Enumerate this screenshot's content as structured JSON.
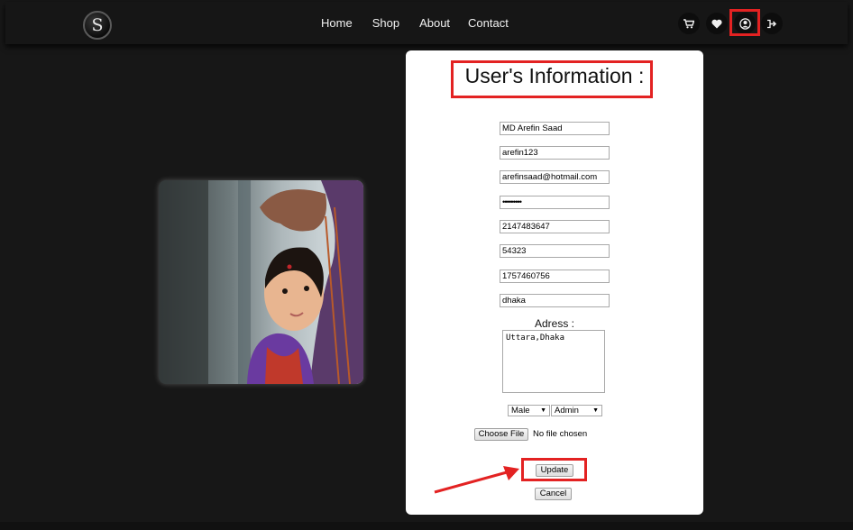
{
  "header": {
    "logo_letter": "S",
    "nav": [
      "Home",
      "Shop",
      "About",
      "Contact"
    ],
    "icons": [
      "cart-icon",
      "heart-icon",
      "user-icon",
      "logout-icon"
    ]
  },
  "form": {
    "title": "User's Information :",
    "fields": [
      "MD Arefin Saad",
      "arefin123",
      "arefinsaad@hotmail.com",
      "•••••••••",
      "2147483647",
      "54323",
      "1757460756",
      "dhaka"
    ],
    "adress_label": "Adress :",
    "adress_value": "Uttara,Dhaka",
    "gender": "Male",
    "role": "Admin",
    "choose_file": "Choose File",
    "no_file": "No file chosen",
    "update": "Update",
    "cancel": "Cancel"
  },
  "colors": {
    "background": "#171717",
    "annotation": "#e32222"
  }
}
